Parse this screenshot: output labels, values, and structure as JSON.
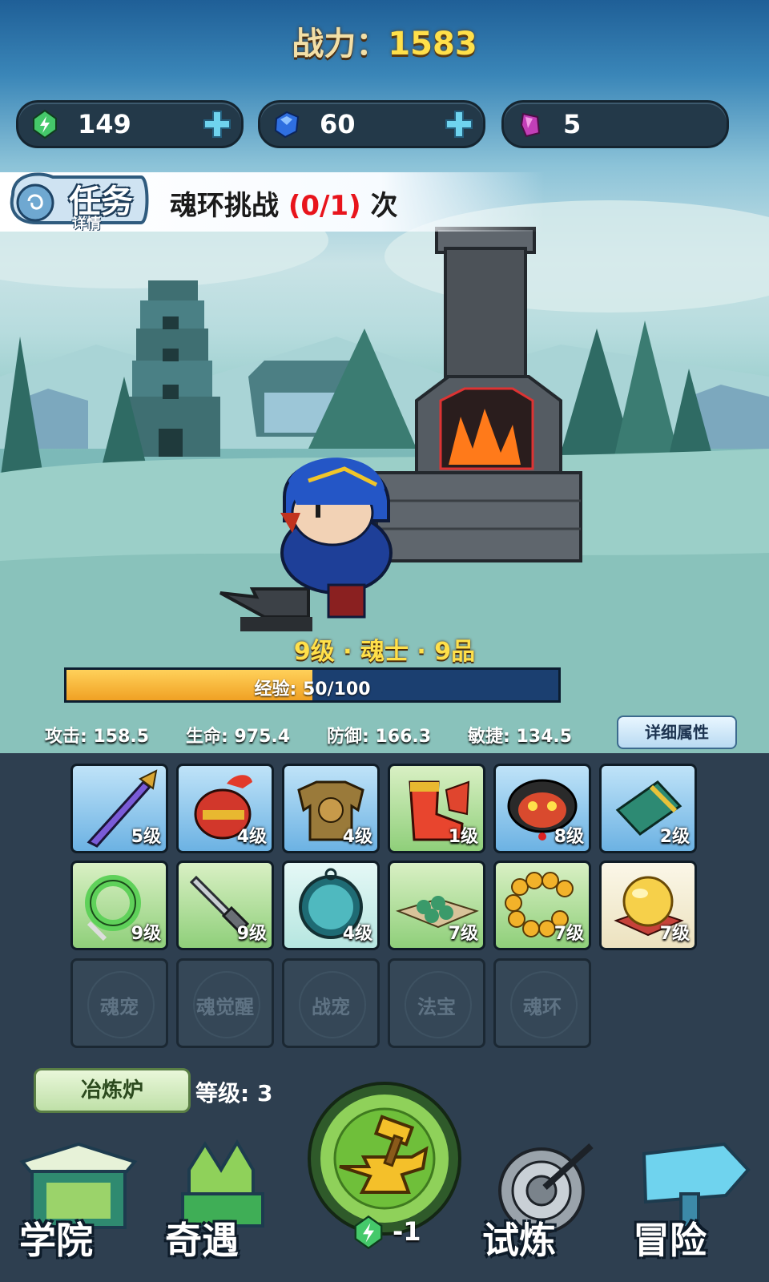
{
  "header": {
    "power_label": "战力",
    "power_sep": "：",
    "power_value": "1583"
  },
  "resources": [
    {
      "icon": "green-energy-crystal-icon",
      "value": "149",
      "has_plus": true
    },
    {
      "icon": "blue-gem-icon",
      "value": "60",
      "has_plus": true
    },
    {
      "icon": "purple-crystal-icon",
      "value": "5",
      "has_plus": false
    }
  ],
  "task": {
    "badge_title": "任务",
    "badge_sub": "详情",
    "text_prefix": "魂环挑战",
    "progress": "(0/1)",
    "text_suffix": "次"
  },
  "character": {
    "level_line": "9级 · 魂士 · 9品",
    "exp_label": "经验: 50/100",
    "exp_current": 50,
    "exp_max": 100
  },
  "stats": [
    {
      "label": "攻击: 158.5"
    },
    {
      "label": "生命: 975.4"
    },
    {
      "label": "防御: 166.3"
    },
    {
      "label": "敏捷: 134.5"
    }
  ],
  "detail_button": "详细属性",
  "equipment": [
    {
      "name": "sword",
      "level": "5级"
    },
    {
      "name": "helmet",
      "level": "4级"
    },
    {
      "name": "armor",
      "level": "4级"
    },
    {
      "name": "boots",
      "level": "1级"
    },
    {
      "name": "mask",
      "level": "8级"
    },
    {
      "name": "bracer",
      "level": "2级"
    },
    {
      "name": "jade-ring",
      "level": "9级"
    },
    {
      "name": "dagger",
      "level": "9级"
    },
    {
      "name": "mirror",
      "level": "4级"
    },
    {
      "name": "beads-tray",
      "level": "7级"
    },
    {
      "name": "bead-necklace",
      "level": "7级"
    },
    {
      "name": "golden-orb",
      "level": "7级"
    }
  ],
  "locked_slots": [
    "魂宠",
    "魂觉醒",
    "战宠",
    "法宝",
    "魂环"
  ],
  "furnace": {
    "label": "冶炼炉",
    "level": "等级: 3",
    "cost": "-1"
  },
  "nav": {
    "academy": "学院",
    "encounter": "奇遇",
    "trial": "试炼",
    "adventure": "冒险"
  },
  "colors": {
    "gold": "#ffe04a",
    "task_red": "#e8141c",
    "panel": "#2e3f50"
  }
}
